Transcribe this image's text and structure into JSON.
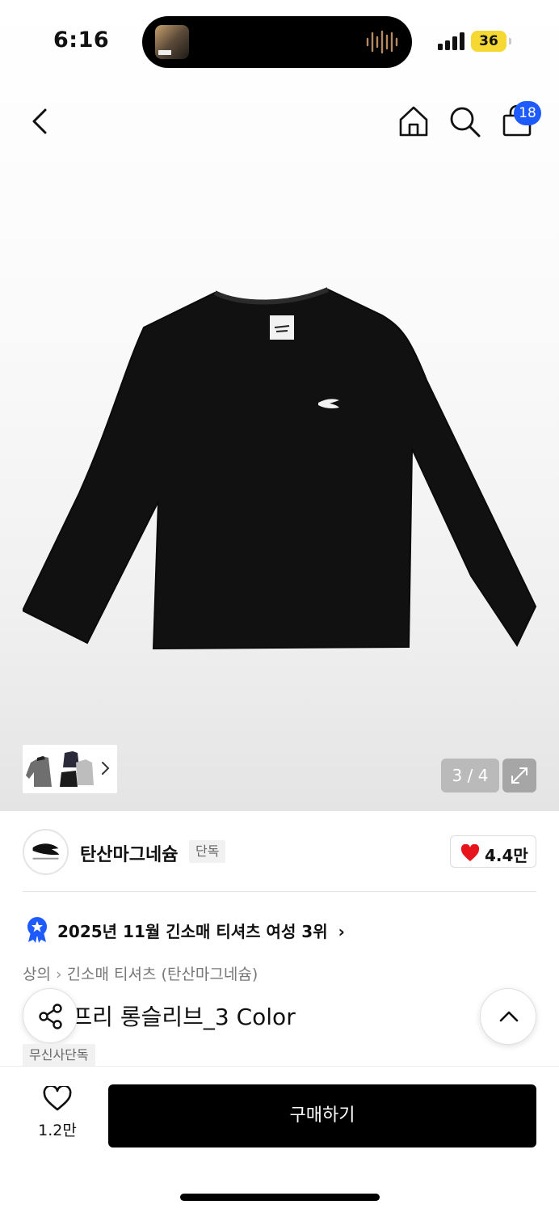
{
  "status_bar": {
    "time": "6:16",
    "battery": "36",
    "battery_color": "#f5d832"
  },
  "nav": {
    "back_icon": "chevron-left-icon",
    "home_icon": "home-icon",
    "search_icon": "search-icon",
    "cart_icon": "shopping-bag-icon",
    "cart_count": "18",
    "badge_color": "#1e5bff"
  },
  "gallery": {
    "counter": "3 / 4",
    "expand_icon": "expand-icon"
  },
  "brand": {
    "name": "탄산마그네슘",
    "tag": "단독",
    "like_count": "4.4만",
    "heart_color": "#e8141c"
  },
  "ranking": {
    "text": "2025년 11월 긴소매 티셔츠 여성 3위",
    "arrow": "›"
  },
  "breadcrumb": {
    "category": "상의",
    "subcategory": "긴소매 티셔츠 (탄산마그네슘)"
  },
  "product": {
    "title": "이어 프리 롱슬리브_3 Color",
    "exclusive_tag": "무신사단독"
  },
  "bottom": {
    "wish_count": "1.2만",
    "buy_label": "구매하기"
  }
}
